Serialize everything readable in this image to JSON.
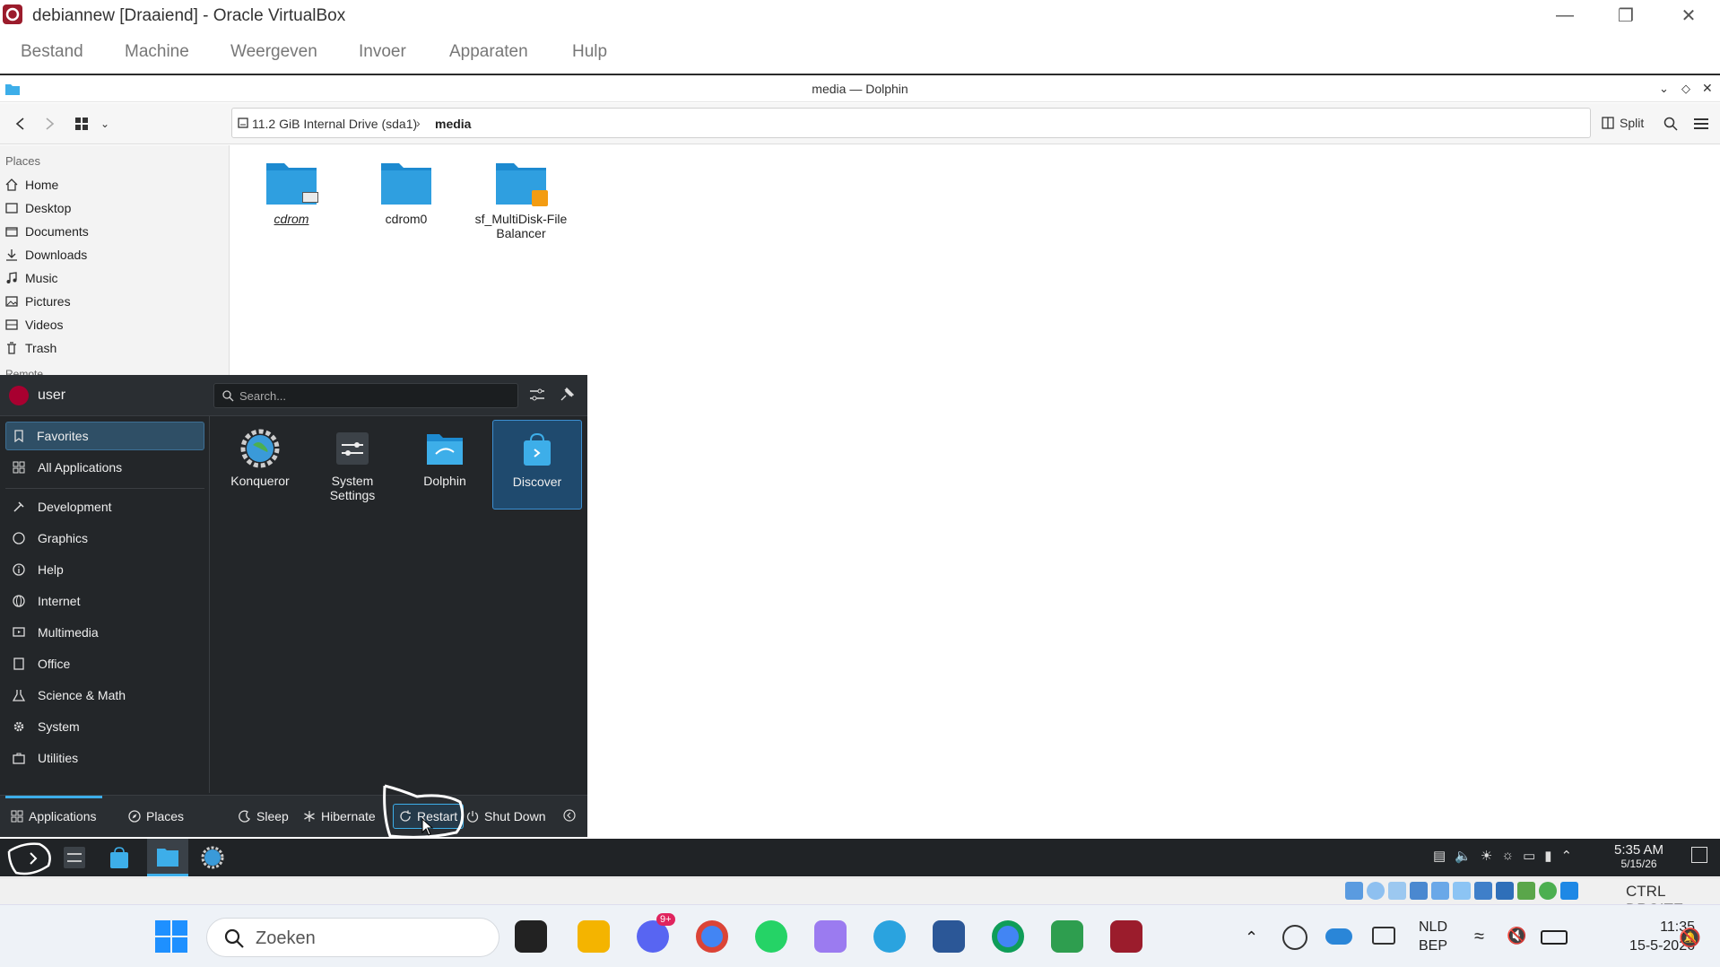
{
  "vbox": {
    "title": "debiannew [Draaiend] - Oracle VirtualBox",
    "menu": [
      "Bestand",
      "Machine",
      "Weergeven",
      "Invoer",
      "Apparaten",
      "Hulp"
    ],
    "host_key": "CTRL DROITE"
  },
  "dolphin": {
    "title": "media — Dolphin",
    "breadcrumb": {
      "drive": "11.2 GiB Internal Drive (sda1)",
      "current": "media"
    },
    "split_label": "Split",
    "places_header": "Places",
    "places": [
      "Home",
      "Desktop",
      "Documents",
      "Downloads",
      "Music",
      "Pictures",
      "Videos",
      "Trash"
    ],
    "remote_header": "Remote",
    "folders": [
      {
        "name": "cdrom",
        "italic": true
      },
      {
        "name": "cdrom0",
        "italic": false
      },
      {
        "name": "sf_MultiDisk-File Balancer",
        "italic": false
      }
    ]
  },
  "launcher": {
    "user": "user",
    "search_placeholder": "Search...",
    "categories": [
      "Favorites",
      "All Applications",
      "Development",
      "Graphics",
      "Help",
      "Internet",
      "Multimedia",
      "Office",
      "Science & Math",
      "System",
      "Utilities"
    ],
    "selected_category": "Favorites",
    "favorites": [
      "Konqueror",
      "System Settings",
      "Dolphin",
      "Discover"
    ],
    "selected_app": "Discover",
    "tabs": [
      "Applications",
      "Places"
    ],
    "power": [
      "Sleep",
      "Hibernate",
      "Restart",
      "Shut Down"
    ]
  },
  "kde_panel": {
    "time": "5:35 AM",
    "date": "5/15/26"
  },
  "windows": {
    "search_placeholder": "Zoeken",
    "lang": "NLD",
    "layout": "BEP",
    "time": "11:35",
    "date": "15-5-2026",
    "discord_badge": "9+"
  },
  "colors": {
    "accent": "#3daee9",
    "folder": "#2f9fe0",
    "debian_red": "#a80030"
  }
}
